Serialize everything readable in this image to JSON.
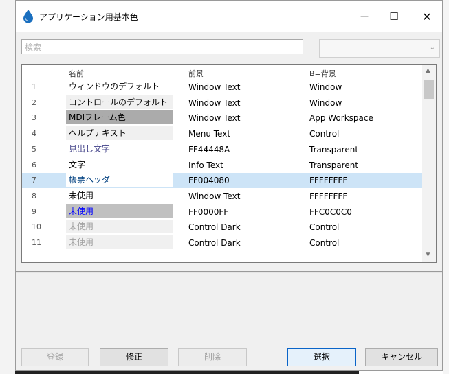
{
  "window": {
    "title": "アプリケーション用基本色",
    "minimize_glyph": "—",
    "maximize_glyph": "☐",
    "close_glyph": "✕"
  },
  "search": {
    "placeholder": "検索"
  },
  "table": {
    "columns": [
      "名前",
      "前景",
      "B=背景"
    ],
    "rows": [
      {
        "no": "1",
        "name": "ウィンドウのデフォルト",
        "fg": "Window Text",
        "bg": "Window",
        "name_bg": "#ffffff",
        "name_color": "#000000"
      },
      {
        "no": "2",
        "name": "コントロールのデフォルト",
        "fg": "Window Text",
        "bg": "Window",
        "name_bg": "#f0f0f0",
        "name_color": "#000000"
      },
      {
        "no": "3",
        "name": "MDIフレーム色",
        "fg": "Window Text",
        "bg": "App Workspace",
        "name_bg": "#ababab",
        "name_color": "#000000"
      },
      {
        "no": "4",
        "name": "ヘルプテキスト",
        "fg": "Menu Text",
        "bg": "Control",
        "name_bg": "#f0f0f0",
        "name_color": "#000000"
      },
      {
        "no": "5",
        "name": "見出し文字",
        "fg": "FF44448A",
        "bg": "Transparent",
        "name_bg": "#ffffff",
        "name_color": "#44448a"
      },
      {
        "no": "6",
        "name": "文字",
        "fg": "Info Text",
        "bg": "Transparent",
        "name_bg": "#ffffff",
        "name_color": "#000000"
      },
      {
        "no": "7",
        "name": "帳票ヘッダ",
        "fg": "FF004080",
        "bg": "FFFFFFFF",
        "name_bg": "#ffffff",
        "name_color": "#004080"
      },
      {
        "no": "8",
        "name": "未使用",
        "fg": "Window Text",
        "bg": "FFFFFFFF",
        "name_bg": "#ffffff",
        "name_color": "#000000"
      },
      {
        "no": "9",
        "name": "未使用",
        "fg": "FF0000FF",
        "bg": "FFC0C0C0",
        "name_bg": "#c0c0c0",
        "name_color": "#0000ff"
      },
      {
        "no": "10",
        "name": "未使用",
        "fg": "Control Dark",
        "bg": "Control",
        "name_bg": "#f0f0f0",
        "name_color": "#a0a0a0"
      },
      {
        "no": "11",
        "name": "未使用",
        "fg": "Control Dark",
        "bg": "Control",
        "name_bg": "#f0f0f0",
        "name_color": "#a0a0a0"
      }
    ],
    "selected_row": 7
  },
  "buttons": {
    "register": "登録",
    "modify": "修正",
    "delete": "削除",
    "select": "選択",
    "cancel": "キャンセル"
  },
  "colors": {
    "selection": "#cde4f7",
    "accent": "#0a64c8",
    "icon": "#1a6fbf"
  }
}
